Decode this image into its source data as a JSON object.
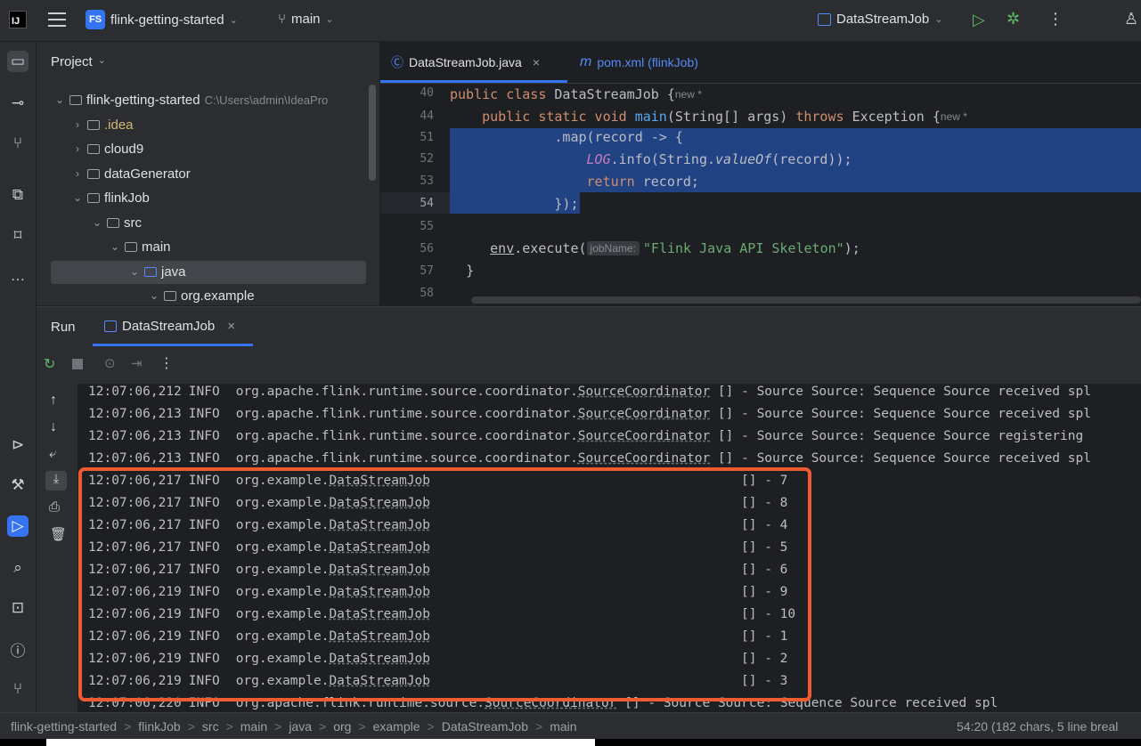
{
  "titlebar": {
    "logo": "IJ",
    "project_badge": "FS",
    "project_name": "flink-getting-started",
    "branch": "main",
    "run_config": "DataStreamJob"
  },
  "project_panel": {
    "title": "Project",
    "tree": [
      {
        "label": "flink-getting-started",
        "path_hint": "C:\\Users\\admin\\IdeaPro",
        "expanded": true
      },
      {
        "label": ".idea",
        "expanded": false
      },
      {
        "label": "cloud9",
        "expanded": false
      },
      {
        "label": "dataGenerator",
        "expanded": false
      },
      {
        "label": "flinkJob",
        "expanded": true
      },
      {
        "label": "src",
        "expanded": true
      },
      {
        "label": "main",
        "expanded": true
      },
      {
        "label": "java",
        "expanded": true,
        "selected": true
      },
      {
        "label": "org.example",
        "expanded": true
      }
    ]
  },
  "editor": {
    "tabs": [
      {
        "label": "DataStreamJob.java",
        "active": true,
        "close": "×"
      },
      {
        "label": "pom.xml (flinkJob)",
        "active": false
      }
    ],
    "line_numbers": [
      "40",
      "44",
      "51",
      "52",
      "53",
      "54",
      "55",
      "56",
      "57",
      "58"
    ],
    "lines": {
      "l40_kw": "public class ",
      "l40_name": "DataStreamJob {",
      "l40_hint": "new *",
      "l44_kw1": "public static void ",
      "l44_fn": "main",
      "l44_rest": "(String[] args) ",
      "l44_kw2": "throws ",
      "l44_exc": "Exception {",
      "l44_hint": "new *",
      "l51": ".map(record -> {",
      "l52_log": "LOG",
      "l52_mid": ".info(String.",
      "l52_vo": "valueOf",
      "l52_end": "(record));",
      "l53_kw": "return ",
      "l53_rest": "record;",
      "l54": "});",
      "l56_env": "env",
      "l56_call": ".execute(",
      "l56_inlay": "jobName:",
      "l56_str": "\"Flink Java API Skeleton\"",
      "l56_end": ");",
      "l57": "}"
    }
  },
  "run_panel": {
    "title": "Run",
    "tab": "DataStreamJob",
    "tab_close": "×",
    "log_lines": [
      {
        "time": "12:07:06,212",
        "level": "INFO",
        "pkg": "org.apache.flink.runtime.source.coordinator.",
        "cls": "SourceCoordinator",
        "msg": " [] - Source Source: Sequence Source received spl"
      },
      {
        "time": "12:07:06,213",
        "level": "INFO",
        "pkg": "org.apache.flink.runtime.source.coordinator.",
        "cls": "SourceCoordinator",
        "msg": " [] - Source Source: Sequence Source received spl"
      },
      {
        "time": "12:07:06,213",
        "level": "INFO",
        "pkg": "org.apache.flink.runtime.source.coordinator.",
        "cls": "SourceCoordinator",
        "msg": " [] - Source Source: Sequence Source registering"
      },
      {
        "time": "12:07:06,213",
        "level": "INFO",
        "pkg": "org.apache.flink.runtime.source.coordinator.",
        "cls": "SourceCoordinator",
        "msg": " [] - Source Source: Sequence Source received spl"
      },
      {
        "time": "12:07:06,217",
        "level": "INFO",
        "pkg": "org.example.",
        "cls": "DataStreamJob",
        "msg": "[] - 7"
      },
      {
        "time": "12:07:06,217",
        "level": "INFO",
        "pkg": "org.example.",
        "cls": "DataStreamJob",
        "msg": "[] - 8"
      },
      {
        "time": "12:07:06,217",
        "level": "INFO",
        "pkg": "org.example.",
        "cls": "DataStreamJob",
        "msg": "[] - 4"
      },
      {
        "time": "12:07:06,217",
        "level": "INFO",
        "pkg": "org.example.",
        "cls": "DataStreamJob",
        "msg": "[] - 5"
      },
      {
        "time": "12:07:06,217",
        "level": "INFO",
        "pkg": "org.example.",
        "cls": "DataStreamJob",
        "msg": "[] - 6"
      },
      {
        "time": "12:07:06,219",
        "level": "INFO",
        "pkg": "org.example.",
        "cls": "DataStreamJob",
        "msg": "[] - 9"
      },
      {
        "time": "12:07:06,219",
        "level": "INFO",
        "pkg": "org.example.",
        "cls": "DataStreamJob",
        "msg": "[] - 10"
      },
      {
        "time": "12:07:06,219",
        "level": "INFO",
        "pkg": "org.example.",
        "cls": "DataStreamJob",
        "msg": "[] - 1"
      },
      {
        "time": "12:07:06,219",
        "level": "INFO",
        "pkg": "org.example.",
        "cls": "DataStreamJob",
        "msg": "[] - 2"
      },
      {
        "time": "12:07:06,219",
        "level": "INFO",
        "pkg": "org.example.",
        "cls": "DataStreamJob",
        "msg": "[] - 3"
      },
      {
        "time": "12:07:06,220",
        "level": "INFO",
        "pkg": "org.apache.flink.runtime.source.",
        "cls": "SourceCoordinator",
        "msg": " [] - Source Source: Sequence Source received spl"
      }
    ]
  },
  "statusbar": {
    "breadcrumb": [
      "flink-getting-started",
      "flinkJob",
      "src",
      "main",
      "java",
      "org",
      "example",
      "DataStreamJob",
      "main"
    ],
    "separator": ">",
    "position": "54:20 (182 chars, 5 line breal"
  },
  "colors": {
    "accent": "#3574f0",
    "selection": "#214283",
    "highlight_box": "#ef5b2f"
  }
}
